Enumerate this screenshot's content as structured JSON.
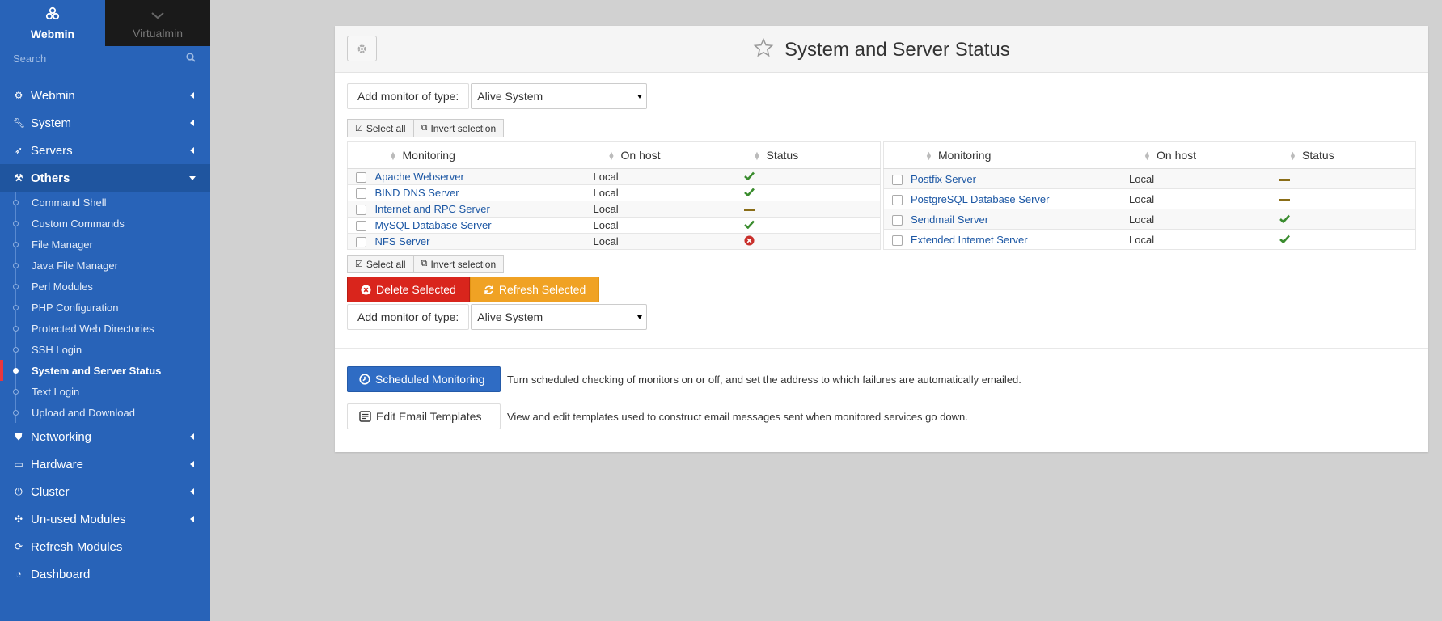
{
  "sidebar": {
    "tabs": [
      {
        "label": "Webmin",
        "icon": "webmin-logo-icon"
      },
      {
        "label": "Virtualmin",
        "icon": "chevron-down-icon"
      }
    ],
    "search_placeholder": "Search",
    "menu_top": [
      {
        "label": "Webmin",
        "icon": "gear-icon"
      },
      {
        "label": "System",
        "icon": "wrench-icon"
      },
      {
        "label": "Servers",
        "icon": "rocket-icon"
      },
      {
        "label": "Others",
        "icon": "gavel-icon"
      }
    ],
    "others_items": [
      {
        "label": "Command Shell"
      },
      {
        "label": "Custom Commands"
      },
      {
        "label": "File Manager"
      },
      {
        "label": "Java File Manager"
      },
      {
        "label": "Perl Modules"
      },
      {
        "label": "PHP Configuration"
      },
      {
        "label": "Protected Web Directories"
      },
      {
        "label": "SSH Login"
      },
      {
        "label": "System and Server Status"
      },
      {
        "label": "Text Login"
      },
      {
        "label": "Upload and Download"
      }
    ],
    "active_item": "System and Server Status",
    "menu_bottom": [
      {
        "label": "Networking",
        "icon": "shield-icon"
      },
      {
        "label": "Hardware",
        "icon": "hdd-icon"
      },
      {
        "label": "Cluster",
        "icon": "power-icon"
      },
      {
        "label": "Un-used Modules",
        "icon": "puzzle-icon"
      },
      {
        "label": "Refresh Modules",
        "icon": "refresh-icon"
      },
      {
        "label": "Dashboard",
        "icon": "dashboard-icon"
      }
    ]
  },
  "panel": {
    "title": "System and Server Status",
    "add_monitor": {
      "label": "Add monitor of type:",
      "value": "Alive System"
    },
    "select_all_label": "Select all",
    "invert_selection_label": "Invert selection",
    "columns": [
      "Monitoring",
      "On host",
      "Status"
    ],
    "left_rows": [
      {
        "name": "Apache Webserver",
        "host": "Local",
        "status": "up"
      },
      {
        "name": "BIND DNS Server",
        "host": "Local",
        "status": "up"
      },
      {
        "name": "Internet and RPC Server",
        "host": "Local",
        "status": "unknown"
      },
      {
        "name": "MySQL Database Server",
        "host": "Local",
        "status": "up"
      },
      {
        "name": "NFS Server",
        "host": "Local",
        "status": "down"
      }
    ],
    "right_rows": [
      {
        "name": "Postfix Server",
        "host": "Local",
        "status": "unknown"
      },
      {
        "name": "PostgreSQL Database Server",
        "host": "Local",
        "status": "unknown"
      },
      {
        "name": "Sendmail Server",
        "host": "Local",
        "status": "up"
      },
      {
        "name": "Extended Internet Server",
        "host": "Local",
        "status": "up"
      }
    ],
    "delete_label": "Delete Selected",
    "refresh_label": "Refresh Selected",
    "scheduled_label": "Scheduled Monitoring",
    "scheduled_help": "Turn scheduled checking of monitors on or off, and set the address to which failures are automatically emailed.",
    "templates_label": "Edit Email Templates",
    "templates_help": "View and edit templates used to construct email messages sent when monitored services go down."
  },
  "colors": {
    "sidebar": "#2863b8",
    "link": "#1c57a4",
    "status_up": "#3a8c2e",
    "status_unknown": "#8a6d17",
    "status_down": "#c9302c",
    "delete": "#d9251c",
    "refresh": "#f0a224",
    "primary": "#2f6cc4"
  }
}
